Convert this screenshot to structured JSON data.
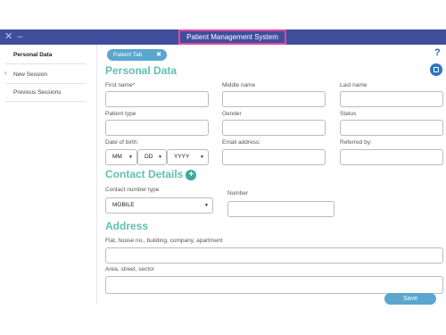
{
  "titlebar": {
    "title": "Patient Management System",
    "icons": "✕ ‒"
  },
  "sidebar": {
    "items": [
      {
        "label": "Personal Data",
        "active": true
      },
      {
        "label": "New Session",
        "active": false
      },
      {
        "label": "Previous Sessions",
        "active": false
      }
    ],
    "arrow": "›"
  },
  "tab": {
    "label": "Patient Tab",
    "close": "✖"
  },
  "help": "?",
  "sections": {
    "personal": "Personal Data",
    "contact": "Contact Details",
    "address": "Address"
  },
  "fields": {
    "first_name": "First name*",
    "middle_name": "Middle name",
    "last_name": "Last name",
    "patient_type": "Patient type",
    "gender": "Gender",
    "status": "Status",
    "dob": "Date of birth:",
    "email": "Email address:",
    "referred_by": "Referred by:",
    "contact_type": "Contact number type",
    "number": "Number",
    "flat": "Flat, house no., building, company, apartment",
    "area": "Area, street, sector"
  },
  "dob_selects": {
    "mm": "MM",
    "dd": "DD",
    "yyyy": "YYYY"
  },
  "contact_type_value": "MOBILE",
  "plus": "+",
  "caret": "▼",
  "save_label": "Save",
  "colors": {
    "titlebar": "#3f4f9c",
    "accent": "#5fbfb3",
    "button": "#5aa6cf",
    "highlight": "#e2469a"
  }
}
